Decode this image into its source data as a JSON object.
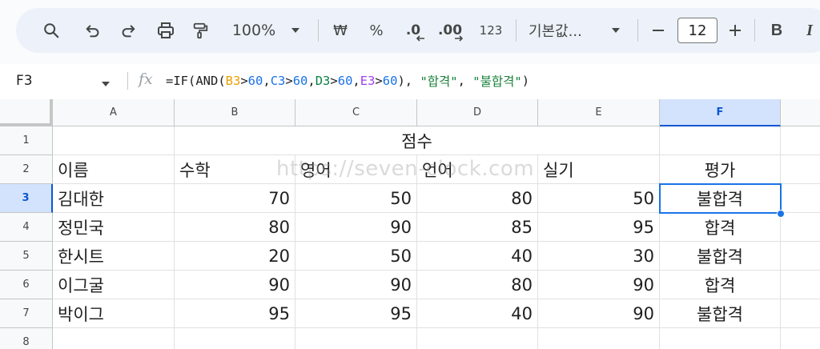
{
  "toolbar": {
    "zoom": "100%",
    "currency": "₩",
    "percent": "%",
    "decrease_decimal": ".0",
    "increase_decimal": ".00",
    "number_format": "123",
    "font": "기본값...",
    "font_size": "12",
    "bold": "B",
    "italic": "I"
  },
  "formula_bar": {
    "cell_ref": "F3",
    "fx": "fx",
    "formula_parts": [
      "=IF(AND(",
      "B3",
      ">",
      "60",
      ",",
      "C3",
      ">",
      "60",
      ",",
      "D3",
      ">",
      "60",
      ",",
      "E3",
      ">",
      "60",
      "), ",
      "\"합격\"",
      ", ",
      "\"불합격\"",
      ")"
    ]
  },
  "columns": [
    "A",
    "B",
    "C",
    "D",
    "E",
    "F"
  ],
  "rows": [
    "1",
    "2",
    "3",
    "4",
    "5",
    "6",
    "7",
    "8"
  ],
  "sheet": {
    "title": "점수",
    "headers": {
      "name": "이름",
      "math": "수학",
      "english": "영어",
      "language": "언어",
      "practical": "실기",
      "evaluation": "평가"
    },
    "records": [
      {
        "name": "김대한",
        "math": "70",
        "english": "50",
        "language": "80",
        "practical": "50",
        "evaluation": "불합격"
      },
      {
        "name": "정민국",
        "math": "80",
        "english": "90",
        "language": "85",
        "practical": "95",
        "evaluation": "합격"
      },
      {
        "name": "한시트",
        "math": "20",
        "english": "50",
        "language": "40",
        "practical": "30",
        "evaluation": "불합격"
      },
      {
        "name": "이그굴",
        "math": "90",
        "english": "90",
        "language": "80",
        "practical": "90",
        "evaluation": "합격"
      },
      {
        "name": "박이그",
        "math": "95",
        "english": "95",
        "language": "40",
        "practical": "90",
        "evaluation": "불합격"
      }
    ]
  },
  "watermark": "https://seven-clock.com",
  "colors": {
    "selection": "#1a73e8",
    "header_selected_bg": "#d3e3fd",
    "toolbar_bg": "#edf2fa"
  }
}
